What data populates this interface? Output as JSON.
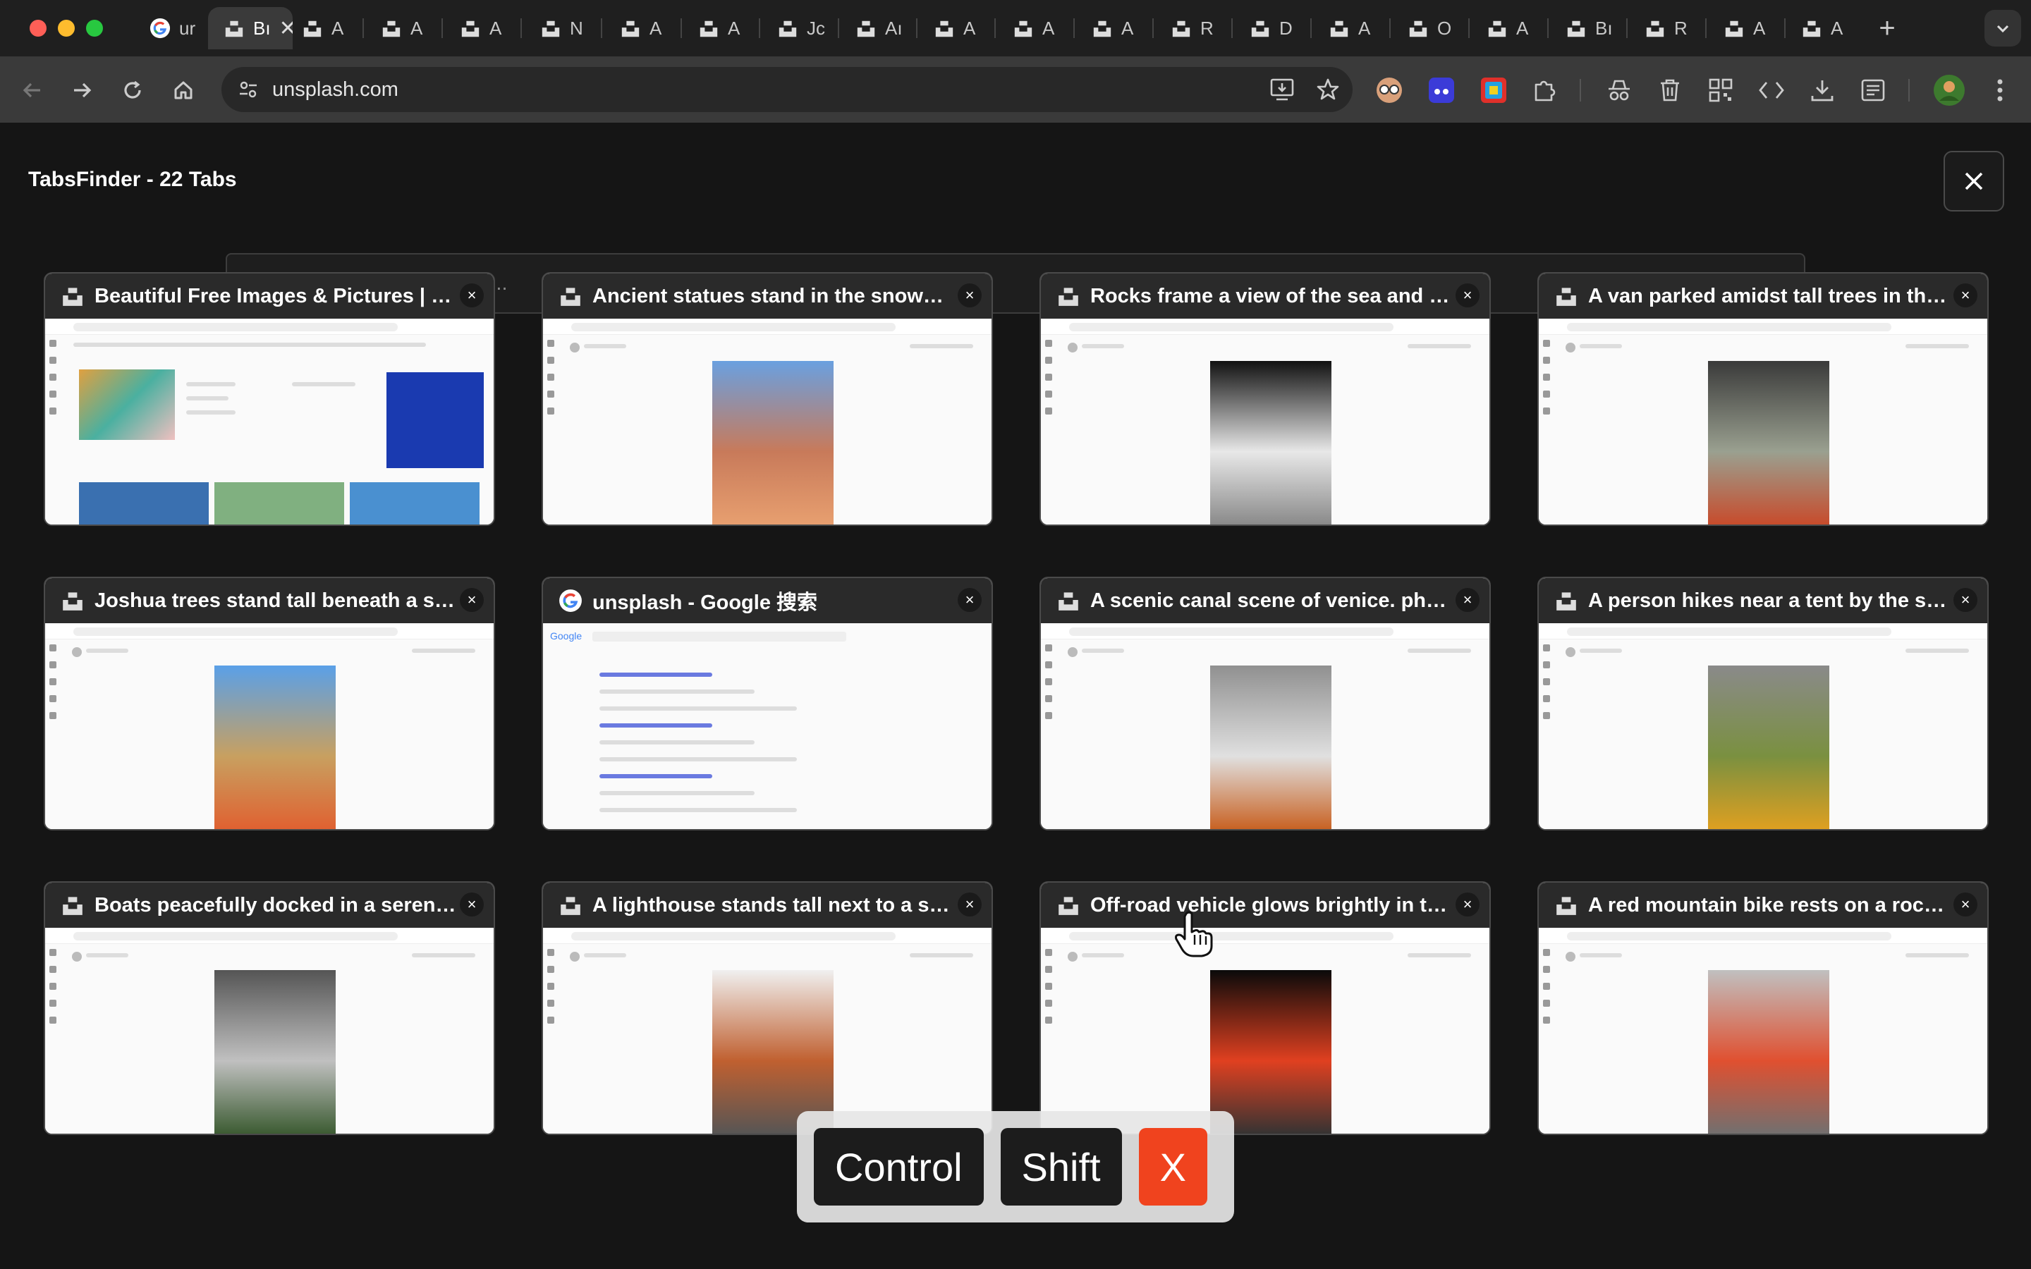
{
  "browser": {
    "tabs": [
      {
        "label": "ur",
        "icon": "google-icon",
        "active": false
      },
      {
        "label": "Bı",
        "icon": "unsplash-icon",
        "active": true
      },
      {
        "label": "A",
        "icon": "unsplash-icon",
        "active": false
      },
      {
        "label": "A",
        "icon": "unsplash-icon",
        "active": false
      },
      {
        "label": "A",
        "icon": "unsplash-icon",
        "active": false
      },
      {
        "label": "N",
        "icon": "unsplash-icon",
        "active": false
      },
      {
        "label": "A",
        "icon": "unsplash-icon",
        "active": false
      },
      {
        "label": "A",
        "icon": "unsplash-icon",
        "active": false
      },
      {
        "label": "Jc",
        "icon": "unsplash-icon",
        "active": false
      },
      {
        "label": "Aı",
        "icon": "unsplash-icon",
        "active": false
      },
      {
        "label": "A",
        "icon": "unsplash-icon",
        "active": false
      },
      {
        "label": "A",
        "icon": "unsplash-icon",
        "active": false
      },
      {
        "label": "A",
        "icon": "unsplash-icon",
        "active": false
      },
      {
        "label": "R",
        "icon": "unsplash-icon",
        "active": false
      },
      {
        "label": "D",
        "icon": "unsplash-icon",
        "active": false
      },
      {
        "label": "A",
        "icon": "unsplash-icon",
        "active": false
      },
      {
        "label": "O",
        "icon": "unsplash-icon",
        "active": false
      },
      {
        "label": "A",
        "icon": "unsplash-icon",
        "active": false
      },
      {
        "label": "Bı",
        "icon": "unsplash-icon",
        "active": false
      },
      {
        "label": "R",
        "icon": "unsplash-icon",
        "active": false
      },
      {
        "label": "A",
        "icon": "unsplash-icon",
        "active": false
      },
      {
        "label": "A",
        "icon": "unsplash-icon",
        "active": false
      }
    ],
    "active_tab_close": "✕",
    "new_tab": "+",
    "address": "unsplash.com",
    "colors": {
      "tabstrip": "#1f1f1f",
      "toolbar": "#3a3a3a",
      "accent_red": "#f0431e"
    }
  },
  "tabsfinder": {
    "title": "TabsFinder - 22 Tabs",
    "search_placeholder": "Search tab title or URL...",
    "cards": [
      {
        "title": "Beautiful Free Images & Pictures | U...",
        "icon": "unsplash-icon",
        "kind": "home"
      },
      {
        "title": "Ancient statues stand in the snowy l...",
        "icon": "unsplash-icon",
        "kind": "photo",
        "palette": [
          "#6aa0e0",
          "#c87a5a",
          "#e8a070"
        ]
      },
      {
        "title": "Rocks frame a view of the sea and s...",
        "icon": "unsplash-icon",
        "kind": "photo",
        "palette": [
          "#111111",
          "#e8e8e8",
          "#888888"
        ]
      },
      {
        "title": "A van parked amidst tall trees in the...",
        "icon": "unsplash-icon",
        "kind": "photo",
        "palette": [
          "#3a3a3a",
          "#9aa090",
          "#c84a2a"
        ]
      },
      {
        "title": "Joshua trees stand tall beneath a st...",
        "icon": "unsplash-icon",
        "kind": "photo",
        "palette": [
          "#5aa0e8",
          "#c8a060",
          "#e06030"
        ]
      },
      {
        "title": "unsplash - Google 搜索",
        "icon": "google-icon",
        "kind": "search"
      },
      {
        "title": "A scenic canal scene of venice. phot...",
        "icon": "unsplash-icon",
        "kind": "photo",
        "palette": [
          "#909090",
          "#e0e0e0",
          "#c86020"
        ]
      },
      {
        "title": "A person hikes near a tent by the se...",
        "icon": "unsplash-icon",
        "kind": "photo",
        "palette": [
          "#8a8a8a",
          "#7a9040",
          "#e0a020"
        ]
      },
      {
        "title": "Boats peacefully docked in a serene...",
        "icon": "unsplash-icon",
        "kind": "photo",
        "palette": [
          "#555555",
          "#c0c0c0",
          "#3a5a30"
        ]
      },
      {
        "title": "A lighthouse stands tall next to a sm...",
        "icon": "unsplash-icon",
        "kind": "photo",
        "palette": [
          "#f0f0f0",
          "#c06030",
          "#555555"
        ]
      },
      {
        "title": "Off-road vehicle glows brightly in th...",
        "icon": "unsplash-icon",
        "kind": "photo",
        "palette": [
          "#0a0a0a",
          "#e04020",
          "#333333"
        ]
      },
      {
        "title": "A red mountain bike rests on a rock...",
        "icon": "unsplash-icon",
        "kind": "photo",
        "palette": [
          "#c0c0c0",
          "#e05030",
          "#707070"
        ]
      }
    ],
    "card_close": "×"
  },
  "keystroke_overlay": {
    "keys": [
      "Control",
      "Shift",
      "X"
    ]
  }
}
